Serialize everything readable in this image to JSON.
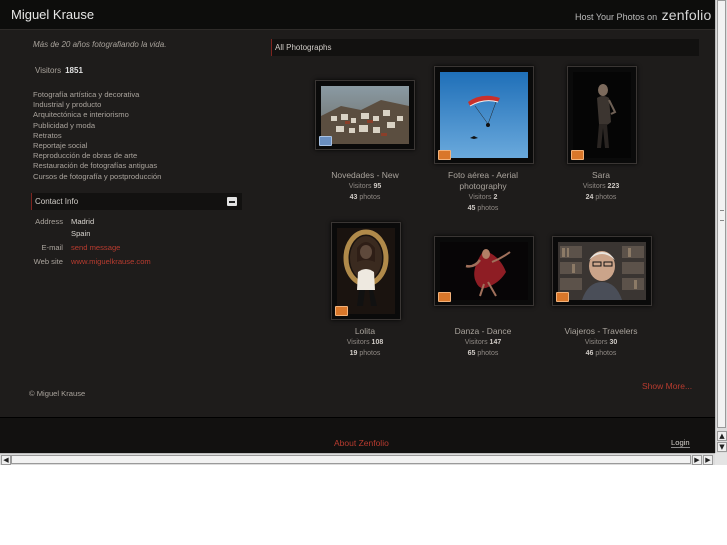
{
  "header": {
    "site_title": "Miguel Krause",
    "host_text": "Host Your Photos on",
    "host_brand": "zenfolio",
    "host_arrow": "»"
  },
  "sidebar": {
    "tagline": "Más de 20 años fotografiando la vida.",
    "visitors_label": "Visitors",
    "visitors_count": "1851",
    "categories": [
      "Fotografía artística y decorativa",
      "Industrial y producto",
      "Arquitectónica e interiorismo",
      "Publicidad y moda",
      "Retratos",
      "Reportaje social",
      "Reproducción de obras de arte",
      "Restauración de fotografías antiguas",
      "Cursos de fotografía y postproducción"
    ],
    "contact": {
      "title": "Contact Info",
      "address_label": "Address",
      "address_line1": "Madrid",
      "address_line2": "Spain",
      "email_label": "E-mail",
      "email_value": "send message",
      "website_label": "Web site",
      "website_value": "www.miguelkrause.com"
    },
    "copyright": "© Miguel Krause"
  },
  "gallery": {
    "heading": "All Photographs",
    "visitors_label": "Visitors",
    "photos_label": "photos",
    "items": [
      {
        "title": "Novedades - New",
        "visitors": "95",
        "photos": "43",
        "badge": "blue"
      },
      {
        "title": "Foto aérea - Aerial photography",
        "visitors": "2",
        "photos": "45",
        "badge": "orange"
      },
      {
        "title": "Sara",
        "visitors": "223",
        "photos": "24",
        "badge": "orange"
      },
      {
        "title": "Lolita",
        "visitors": "108",
        "photos": "19",
        "badge": "orange"
      },
      {
        "title": "Danza - Dance",
        "visitors": "147",
        "photos": "65",
        "badge": "orange"
      },
      {
        "title": "Viajeros - Travelers",
        "visitors": "30",
        "photos": "46",
        "badge": "orange"
      }
    ],
    "show_more": "Show More..."
  },
  "footer": {
    "about": "About Zenfolio",
    "login": "Login"
  },
  "scrollbars": {
    "up": "▲",
    "down": "▼",
    "left": "◀",
    "right": "▶"
  },
  "colors": {
    "background": "#1e1c1b",
    "accent_link": "#b73b2f",
    "panel": "#121110"
  }
}
